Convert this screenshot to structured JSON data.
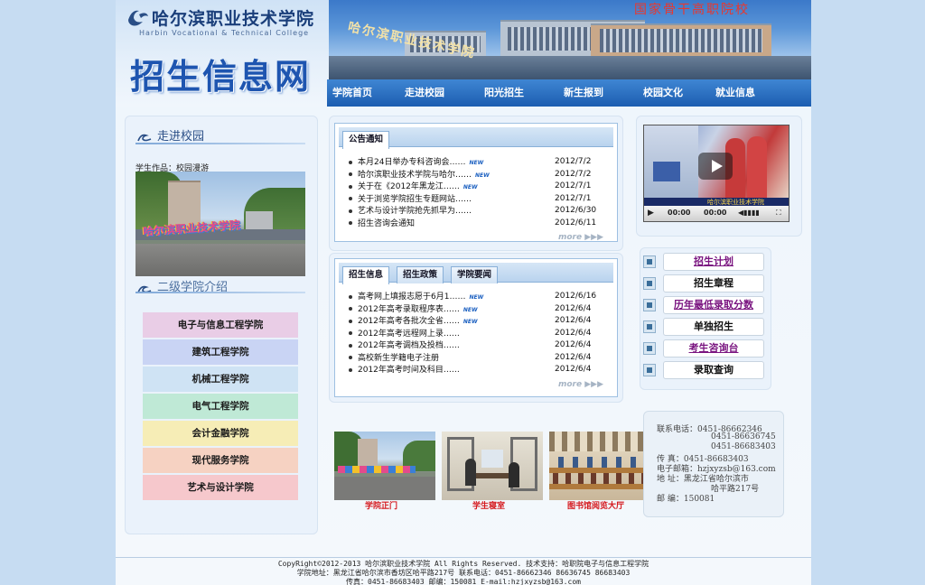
{
  "header": {
    "logo_cn": "哈尔滨职业技术学院",
    "logo_en": "Harbin Vocational & Technical College",
    "site_title": "招生信息网",
    "motto": "国家骨干高职院校",
    "photo_sign": "哈尔滨职业技术学院"
  },
  "nav": [
    "学院首页",
    "走进校园",
    "阳光招生",
    "新生报到",
    "校园文化",
    "就业信息"
  ],
  "left": {
    "campus_title": "走进校园",
    "campus_caption": "学生作品：校园漫游",
    "campus_sign": "哈尔滨职业技术学院",
    "colleges_title": "二级学院介绍",
    "colleges": [
      {
        "name": "电子与信息工程学院",
        "color": "#e9cde6"
      },
      {
        "name": "建筑工程学院",
        "color": "#c9d4f4"
      },
      {
        "name": "机械工程学院",
        "color": "#cfe3f4"
      },
      {
        "name": "电气工程学院",
        "color": "#bfe9d6"
      },
      {
        "name": "会计金融学院",
        "color": "#f6edb6"
      },
      {
        "name": "现代服务学院",
        "color": "#f6d2c2"
      },
      {
        "name": "艺术与设计学院",
        "color": "#f6c8cc"
      }
    ]
  },
  "notice": {
    "tab": "公告通知",
    "badge": "NEW",
    "more": "more",
    "items": [
      {
        "title": "本月24日举办专科咨询会……",
        "date": "2012/7/2",
        "new": true
      },
      {
        "title": "哈尔滨职业技术学院与哈尔……",
        "date": "2012/7/2",
        "new": true
      },
      {
        "title": "关于在《2012年黑龙江……",
        "date": "2012/7/1",
        "new": true
      },
      {
        "title": "关于浏览学院招生专题网站……",
        "date": "2012/7/1",
        "new": false
      },
      {
        "title": "艺术与设计学院抢先抓早为……",
        "date": "2012/6/30",
        "new": false
      },
      {
        "title": "招生咨询会通知",
        "date": "2012/6/11",
        "new": false
      }
    ]
  },
  "admission": {
    "tabs": [
      "招生信息",
      "招生政策",
      "学院要闻"
    ],
    "badge": "NEW",
    "more": "more",
    "items": [
      {
        "title": "高考网上填报志愿于6月1……",
        "date": "2012/6/16",
        "new": true
      },
      {
        "title": "2012年高考录取程序表……",
        "date": "2012/6/4",
        "new": true
      },
      {
        "title": "2012年高考各批次全省……",
        "date": "2012/6/4",
        "new": true
      },
      {
        "title": "2012年高考远程网上录……",
        "date": "2012/6/4",
        "new": false
      },
      {
        "title": "2012年高考调档及投档……",
        "date": "2012/6/4",
        "new": false
      },
      {
        "title": "高校新生学籍电子注册",
        "date": "2012/6/4",
        "new": false
      },
      {
        "title": "2012年高考时间及科目……",
        "date": "2012/6/4",
        "new": false
      }
    ]
  },
  "video": {
    "time_current": "00:00",
    "time_total": "00:00",
    "caption": "哈尔滨职业技术学院"
  },
  "quick_links": [
    {
      "label": "招生计划",
      "style": "purple"
    },
    {
      "label": "招生章程",
      "style": "black"
    },
    {
      "label": "历年最低录取分数",
      "style": "purple"
    },
    {
      "label": "单独招生",
      "style": "black"
    },
    {
      "label": "考生咨询台",
      "style": "purple"
    },
    {
      "label": "录取查询",
      "style": "black"
    }
  ],
  "contact": {
    "lines": [
      "联系电话：0451-86662346",
      "0451-86636745",
      "0451-86683403",
      "传    真：0451-86683403",
      "电子邮箱：hzjxyzsb@163.com",
      "地    址：黑龙江省哈尔滨市",
      "哈平路217号",
      "邮    编：150081"
    ]
  },
  "photos": [
    "学院正门",
    "学生寝室",
    "图书馆阅览大厅"
  ],
  "footer": {
    "line1": "CopyRight©2012-2013 哈尔滨职业技术学院 All Rights Reserved. 技术支持：哈职院电子与信息工程学院",
    "line2": "学院地址：黑龙江省哈尔滨市香坊区哈平路217号      联系电话：0451-86662346 86636745 86683403",
    "line3": "传真：0451-86683403 邮编：150081 E-mail:hzjxyzsb@163.com"
  },
  "colors": {
    "nav": "#1c5db0",
    "link_purple": "#7a1580",
    "caption_red": "#d4161b",
    "motto_red": "#e8382f",
    "title_blue": "#1e55b0"
  }
}
